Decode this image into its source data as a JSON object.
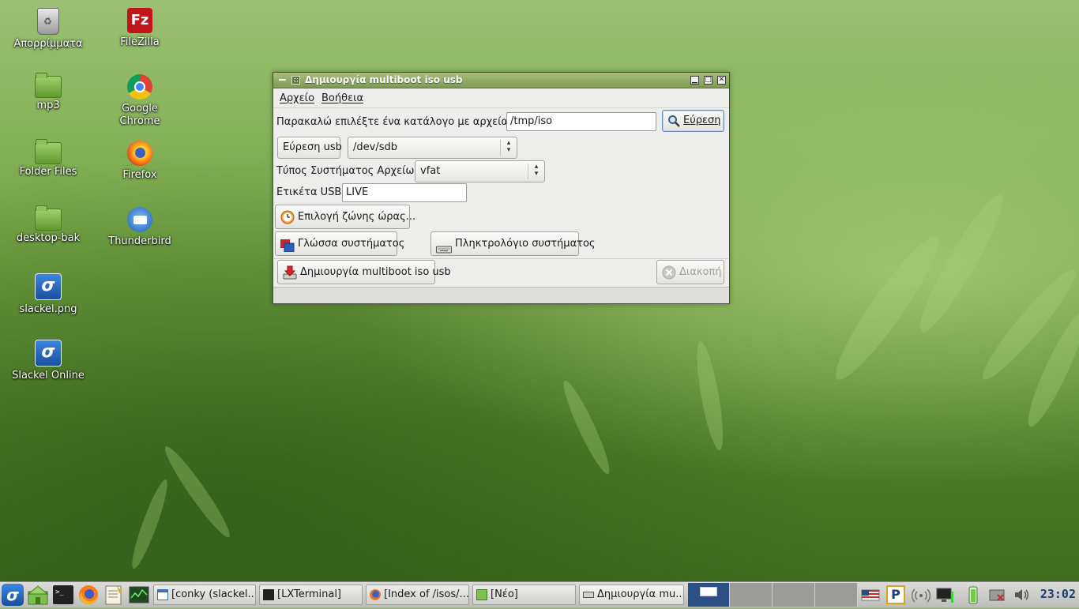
{
  "desktop": {
    "icons": [
      {
        "label": "Απορρίμματα",
        "icon": "trash-icon"
      },
      {
        "label": "FileZilla",
        "icon": "filezilla-icon"
      },
      {
        "label": "mp3",
        "icon": "folder-icon"
      },
      {
        "label": "Google Chrome",
        "icon": "chrome-icon"
      },
      {
        "label": "Folder Files",
        "icon": "folder-icon"
      },
      {
        "label": "Firefox",
        "icon": "firefox-icon"
      },
      {
        "label": "desktop-bak",
        "icon": "folder-icon"
      },
      {
        "label": "Thunderbird",
        "icon": "thunderbird-icon"
      },
      {
        "label": "slackel.png",
        "icon": "slackel-icon"
      },
      {
        "label": "Slackel Online",
        "icon": "slackel-icon"
      }
    ],
    "fz_glyph": "Fz",
    "slackel_glyph": "σ"
  },
  "window": {
    "title": "Δημιουργία multiboot iso usb",
    "controls": {
      "minimize": "▁",
      "maximize": "□",
      "close": "✕"
    },
    "menu": [
      "Αρχείο",
      "Βοήθεια"
    ],
    "iso_prompt": "Παρακαλώ επιλέξτε ένα κατάλογο με αρχεία iso.",
    "iso_path": "/tmp/iso",
    "search_button": "Εύρεση",
    "find_usb_button": "Εύρεση usb",
    "usb_device": "/dev/sdb",
    "fs_label": "Τύπος Συστήματος Αρχείων:",
    "fs_value": "vfat",
    "usb_label_label": "Ετικέτα USB:",
    "usb_label_value": "LIVE",
    "timezone_button": "Επιλογή ζώνης ώρας...",
    "language_button": "Γλώσσα συστήματος",
    "keyboard_button": "Πληκτρολόγιο συστήματος",
    "create_button": "Δημιουργία multiboot iso usb",
    "cancel_button": "Διακοπή"
  },
  "panel": {
    "tasks": [
      {
        "label": "[conky (slackel....",
        "icon": "window-icon"
      },
      {
        "label": "[LXTerminal]",
        "icon": "terminal-icon"
      },
      {
        "label": "[Index of /isos/...",
        "icon": "firefox-icon"
      },
      {
        "label": "[Νέο]",
        "icon": "folder-icon"
      },
      {
        "label": "Δημιουργία mu...",
        "icon": "app-icon"
      }
    ],
    "tray_p": "P",
    "clock": "23:02"
  },
  "colors": {
    "titlebar": "#8fa866",
    "panel": "#cfcfcc",
    "active_desktop": "#2c4f86"
  }
}
